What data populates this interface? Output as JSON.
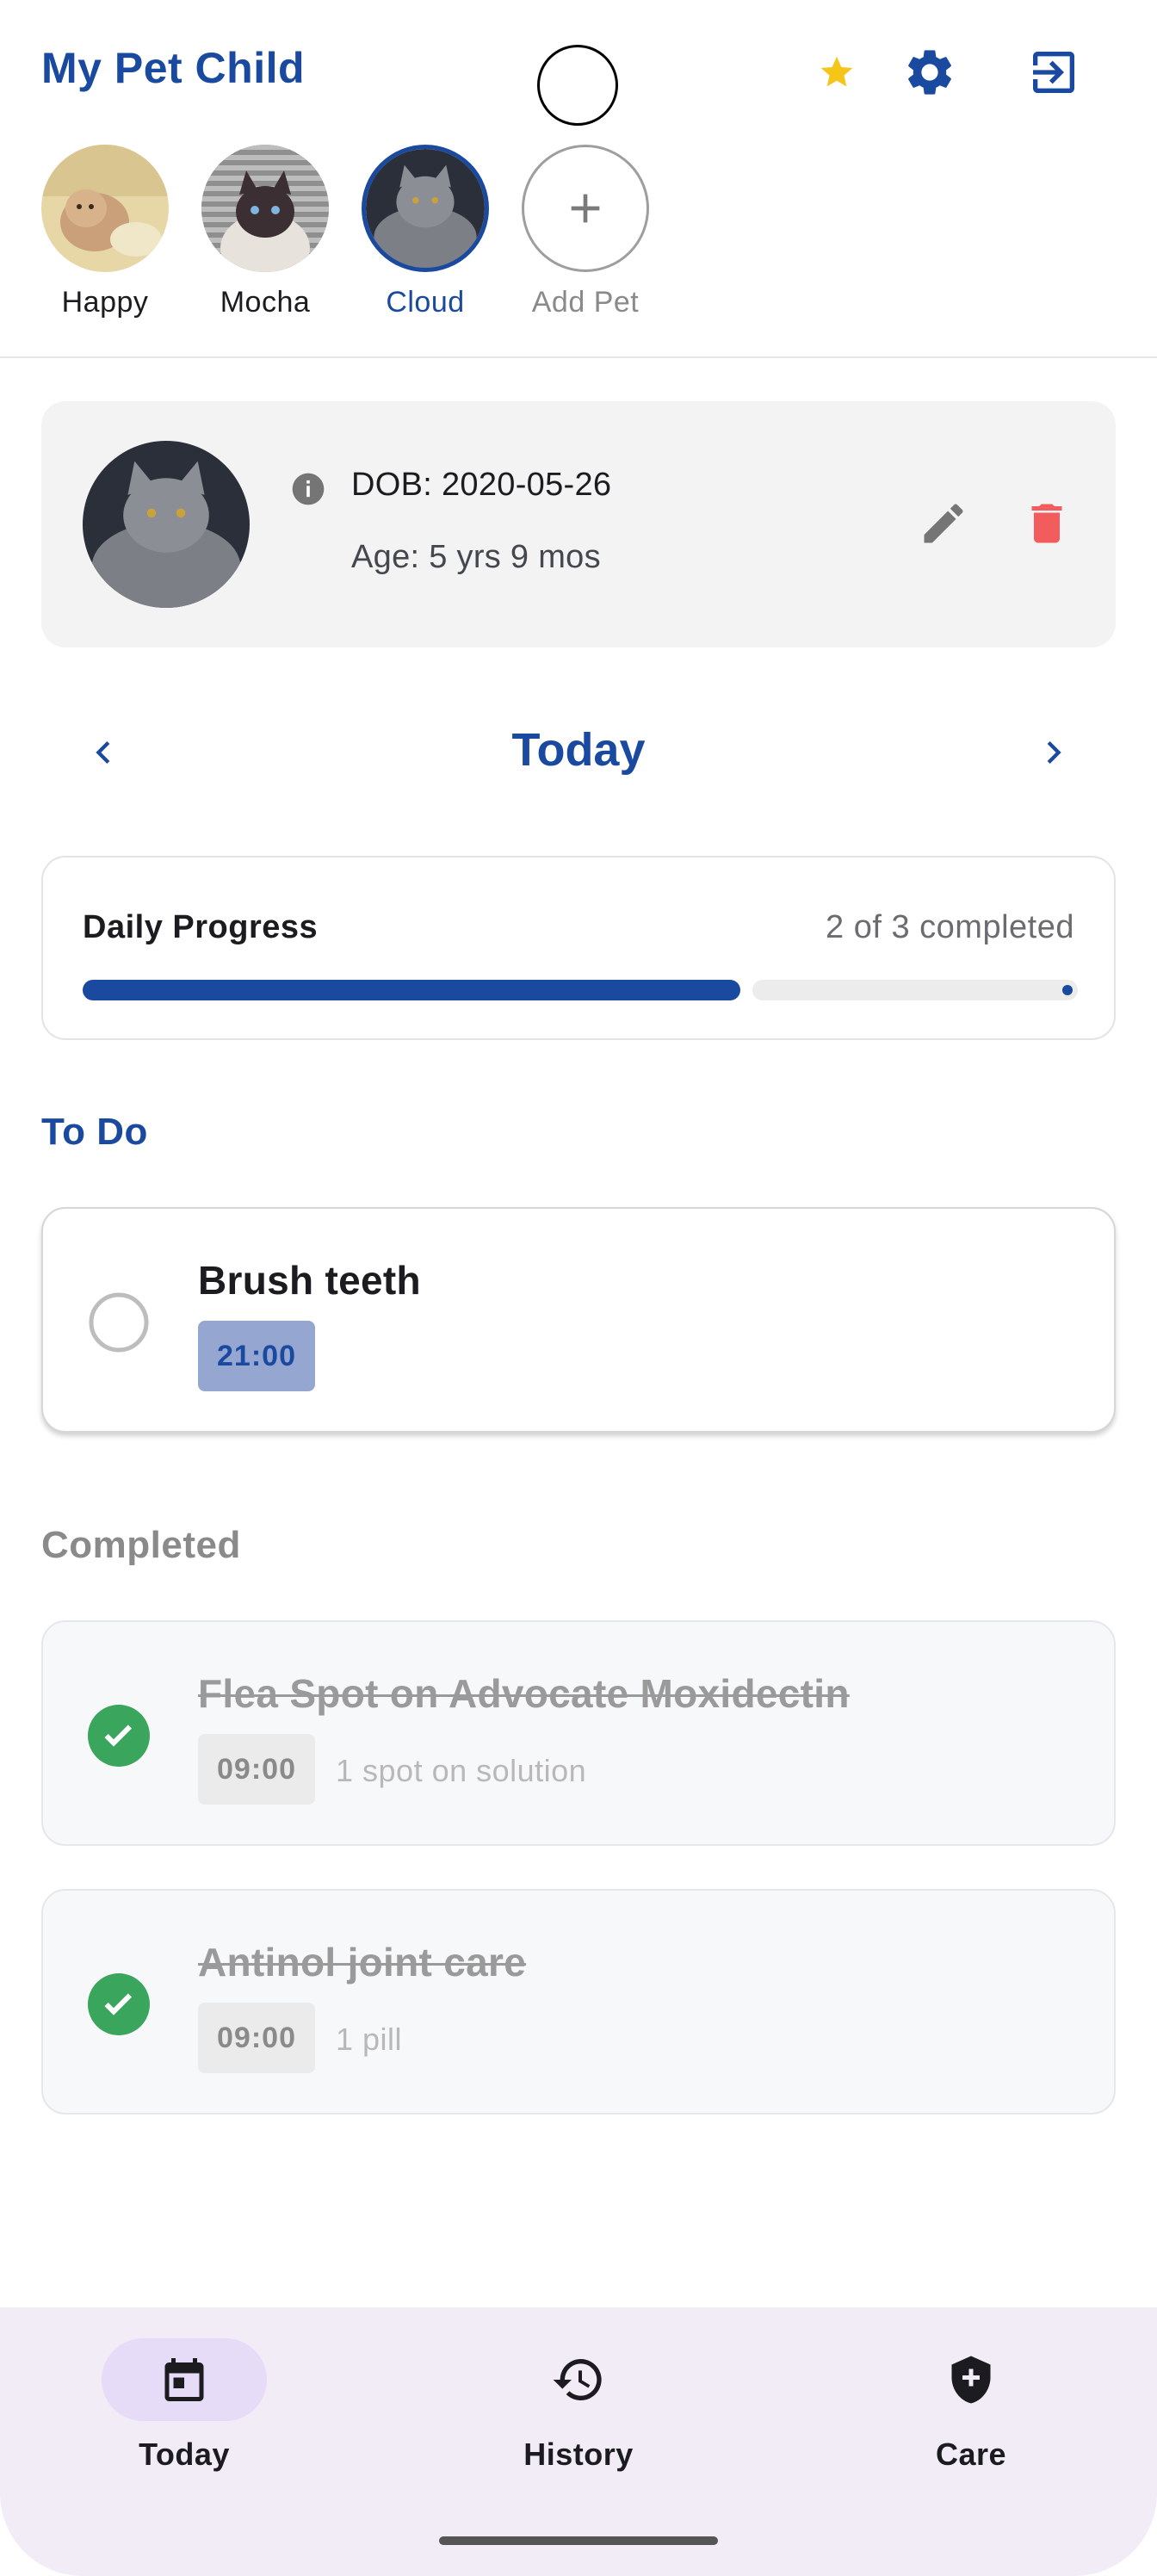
{
  "header": {
    "title": "My Pet Child",
    "icons": [
      "star-icon",
      "gear-icon",
      "exit-icon"
    ],
    "accent_color": "#1a4aa0",
    "star_color": "#f5c518"
  },
  "pets": [
    {
      "name": "Happy",
      "selected": false
    },
    {
      "name": "Mocha",
      "selected": false
    },
    {
      "name": "Cloud",
      "selected": true
    },
    {
      "name": "Add Pet",
      "add": true
    }
  ],
  "pet_info": {
    "dob": "DOB: 2020-05-26",
    "age": "Age: 5 yrs 9 mos",
    "delete_color": "#f25c5c"
  },
  "date_nav": {
    "label": "Today"
  },
  "progress": {
    "title": "Daily Progress",
    "count_text": "2 of 3 completed",
    "completed": 2,
    "total": 3
  },
  "todo": {
    "title": "To Do",
    "items": [
      {
        "title": "Brush teeth",
        "time": "21:00",
        "note": ""
      }
    ]
  },
  "completed": {
    "title": "Completed",
    "check_color": "#3aa55c",
    "items": [
      {
        "title": "Flea Spot on Advocate Moxidectin",
        "time": "09:00",
        "note": "1 spot on solution"
      },
      {
        "title": "Antinol joint care",
        "time": "09:00",
        "note": "1 pill"
      }
    ]
  },
  "bottom_nav": {
    "items": [
      {
        "label": "Today",
        "icon": "calendar-icon",
        "active": true
      },
      {
        "label": "History",
        "icon": "history-icon",
        "active": false
      },
      {
        "label": "Care",
        "icon": "shield-plus-icon",
        "active": false
      }
    ]
  }
}
